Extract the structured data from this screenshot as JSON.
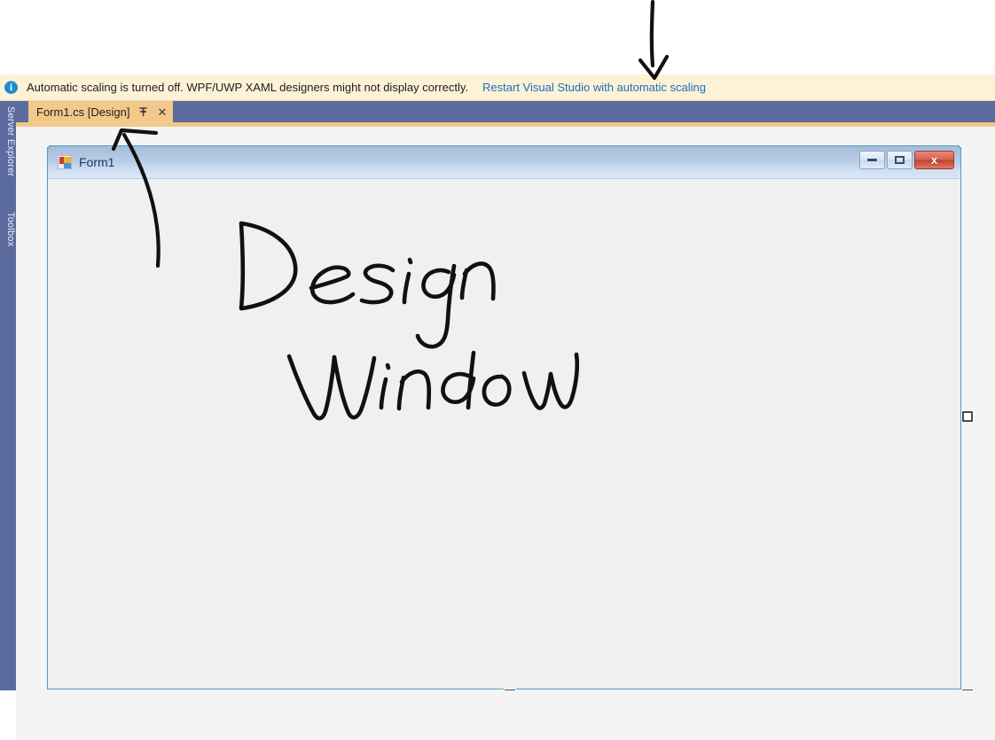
{
  "notification": {
    "icon": "info-icon",
    "message": "Automatic scaling is turned off. WPF/UWP XAML designers might not display correctly.",
    "link_label": "Restart Visual Studio with automatic scaling",
    "background_color": "#fdf2d6",
    "link_color": "#1a6fbf"
  },
  "left_dock": {
    "items": [
      {
        "label": "Server Explorer"
      },
      {
        "label": "Toolbox"
      }
    ],
    "background_color": "#5b6b9e"
  },
  "tabstrip": {
    "active_tab": {
      "label": "Form1.cs [Design]",
      "pin_icon": "pin-icon",
      "close_icon": "close-icon",
      "background_color": "#f2c98b"
    }
  },
  "designer": {
    "background_color": "#f4f4f4",
    "form": {
      "title": "Form1",
      "icon": "windows-form-icon",
      "titlebar_color": "#b7cbe5",
      "client_color": "#f0f0f0",
      "border_color": "#4b9fc4",
      "window_buttons": [
        {
          "name": "minimize-button",
          "glyph": "minimize-glyph"
        },
        {
          "name": "maximize-button",
          "glyph": "maximize-glyph"
        },
        {
          "name": "close-button",
          "glyph": "close-glyph",
          "label": "x",
          "color": "#c2402e"
        }
      ],
      "selected": true,
      "resize_handles": 3
    }
  },
  "annotations": [
    {
      "type": "handwriting",
      "text": "Design",
      "color": "#000000"
    },
    {
      "type": "handwriting",
      "text": "Window",
      "color": "#000000"
    },
    {
      "type": "arrow",
      "name": "arrow-to-restart-link",
      "points_to": "Restart Visual Studio with automatic scaling"
    },
    {
      "type": "arrow",
      "name": "arrow-to-design-tab",
      "points_to": "Form1.cs [Design]"
    }
  ]
}
